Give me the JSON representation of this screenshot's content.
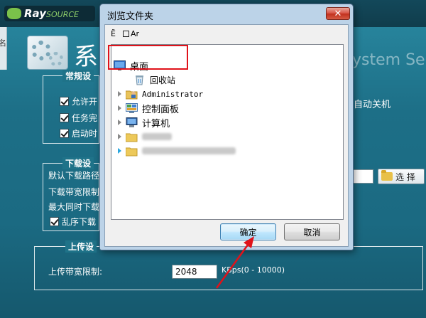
{
  "app": {
    "logo_text": "Ray",
    "logo_sub": "SOURCE",
    "left_strip_label": "名",
    "page_title": "系",
    "page_title_en": "ystem Se",
    "general_group_title": "常规设",
    "general_options": [
      {
        "label": "允许开",
        "checked": true
      },
      {
        "label": "任务完",
        "checked": true
      },
      {
        "label": "启动时",
        "checked": true
      }
    ],
    "auto_shutdown_text": "自动关机",
    "download_group_title": "下载设",
    "default_path_label": "默认下载路径",
    "download_bandwidth_label": "下载带宽限制",
    "max_downloads_label": "最大同时下载",
    "random_download_label": "乱序下载",
    "random_download_checked": true,
    "select_button_label": "选 择",
    "upload_group_title": "上传设",
    "upload_bandwidth_label": "上传带宽限制:",
    "upload_bandwidth_value": "2048",
    "upload_unit_range": "KBps(0 - 10000)"
  },
  "dialog": {
    "title": "浏览文件夹",
    "close_label": "✕",
    "toolbar_left": "Ĕ",
    "toolbar_right": "Ar",
    "tree": [
      {
        "label": "桌面",
        "icon": "desktop-icon"
      },
      {
        "label": "回收站",
        "icon": "recycle-bin-icon"
      },
      {
        "label": "Administrator",
        "icon": "user-folder-icon"
      },
      {
        "label": "控制面板",
        "icon": "control-panel-icon"
      },
      {
        "label": "计算机",
        "icon": "computer-icon"
      },
      {
        "label": "",
        "icon": "folder-icon"
      },
      {
        "label": "",
        "icon": "folder-icon"
      }
    ],
    "ok_label": "确定",
    "cancel_label": "取消"
  },
  "colors": {
    "annotation_red": "#e0121a",
    "app_teal": "#1f6f86",
    "dialog_frame": "#bcd3e8"
  }
}
